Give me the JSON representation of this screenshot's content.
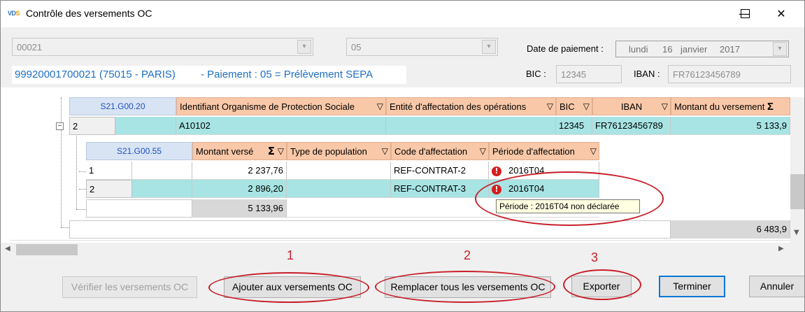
{
  "window": {
    "title": "Contrôle des versements OC",
    "icon_text": "VDS",
    "controls": [
      "minimize-icon",
      "maximize-icon",
      "close-icon"
    ]
  },
  "header": {
    "combo1_value": "00021",
    "combo2_value": "05",
    "date_label": "Date de paiement :",
    "date": {
      "weekday": "lundi",
      "day": "16",
      "month": "janvier",
      "year": "2017"
    },
    "info_line": {
      "entity": "99920001700021 (75015 - PARIS)",
      "payment": "- Paiement : 05 = Prélèvement SEPA"
    },
    "bic_label": "BIC :",
    "bic_value": "12345",
    "iban_label": "IBAN :",
    "iban_value": "FR76123456789"
  },
  "grid_outer": {
    "block_label": "S21.G00.20",
    "columns": [
      "Identifiant Organisme de Protection Sociale",
      "Entité d'affectation des opérations",
      "BIC",
      "IBAN",
      "Montant du versement"
    ],
    "row": {
      "index": "2",
      "id_ops": "A10102",
      "entite": "",
      "bic": "12345",
      "iban": "FR76123456789",
      "montant": "5 133,9"
    },
    "total": "6 483,9"
  },
  "grid_inner": {
    "block_label": "S21.G00.55",
    "columns": [
      "Montant versé",
      "Type de population",
      "Code d'affectation",
      "Période d'affectation"
    ],
    "rows": [
      {
        "index": "1",
        "montant": "2 237,76",
        "type": "",
        "code": "REF-CONTRAT-2",
        "periode": "2016T04"
      },
      {
        "index": "2",
        "montant": "2 896,20",
        "type": "",
        "code": "REF-CONTRAT-3",
        "periode": "2016T04"
      }
    ],
    "total": "5 133,96",
    "warn_symbol": "!"
  },
  "tooltip": "Période : 2016T04 non déclarée",
  "annotations": [
    "1",
    "2",
    "3"
  ],
  "buttons": {
    "verifier": "Vérifier les versements OC",
    "ajouter": "Ajouter aux versements OC",
    "remplacer": "Remplacer tous les versements OC",
    "exporter": "Exporter",
    "terminer": "Terminer",
    "annuler": "Annuler"
  },
  "symbols": {
    "filter": "▽",
    "sigma": "Σ",
    "dropdown": "▾",
    "tree_minus": "−"
  },
  "colors": {
    "header_cell": "#f9c8a8",
    "selected_row": "#a8e4e4",
    "info_text": "#1f6fc2",
    "annotation_red": "#c8202a",
    "warning_red": "#d81c1c"
  }
}
